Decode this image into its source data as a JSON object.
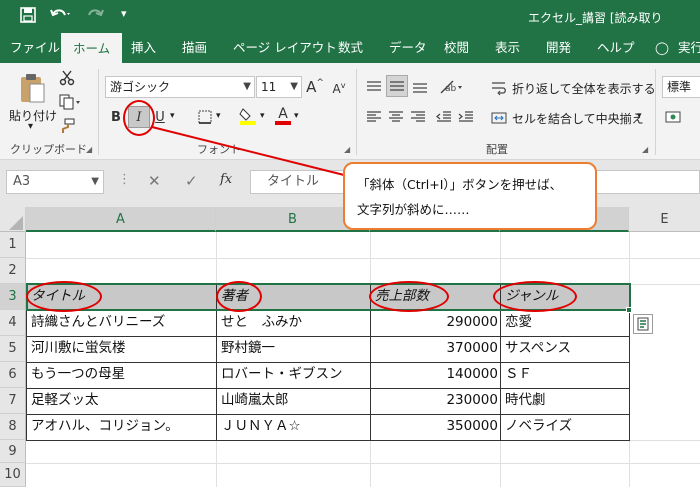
{
  "titlebar": {
    "title": "エクセル_講習 [読み取り",
    "save_icon": "save-icon",
    "undo_icon": "undo-icon",
    "redo_icon": "redo-icon",
    "customize_icon": "customize-quick-access-icon"
  },
  "tabs": [
    "ファイル",
    "ホーム",
    "挿入",
    "描画",
    "ページ レイアウト",
    "数式",
    "データ",
    "校閲",
    "表示",
    "開発",
    "ヘルプ",
    "実行"
  ],
  "ribbon": {
    "clipboard": {
      "paste_label": "貼り付け",
      "group_label": "クリップボード"
    },
    "font": {
      "font_name": "游ゴシック",
      "font_size": "11",
      "bold": "B",
      "italic": "I",
      "underline": "U",
      "grow": "A",
      "shrink": "A",
      "group_label": "フォント"
    },
    "alignment": {
      "wrap_text": "折り返して全体を表示する",
      "merge_center": "セルを結合して中央揃え",
      "group_label": "配置"
    },
    "number": {
      "format": "標準"
    }
  },
  "formula_bar": {
    "name_box": "A3",
    "cancel": "✕",
    "enter": "✓",
    "fx": "fx",
    "content": "タイトル"
  },
  "grid": {
    "columns": [
      "A",
      "B",
      "C",
      "D",
      "E"
    ],
    "rows": [
      "1",
      "2",
      "3",
      "4",
      "5",
      "6",
      "7",
      "8",
      "9",
      "10"
    ],
    "header": [
      "タイトル",
      "著者",
      "売上部数",
      "ジャンル"
    ],
    "data": [
      [
        "詩織さんとバリニーズ",
        "せと　ふみか",
        "290000",
        "恋愛"
      ],
      [
        "河川敷に蛍気楼",
        "野村鏡一",
        "370000",
        "サスペンス"
      ],
      [
        "もう一つの母星",
        "ロバート・ギブスン",
        "140000",
        "ＳＦ"
      ],
      [
        "足軽ズッ太",
        "山崎嵐太郎",
        "230000",
        "時代劇"
      ],
      [
        "アオハル、コリジョン。",
        "ＪＵＮＹＡ☆",
        "350000",
        "ノベライズ"
      ]
    ]
  },
  "callout": {
    "line1": "「斜体（Ctrl+I）」ボタンを押せば、",
    "line2": "文字列が斜めに……"
  },
  "colors": {
    "accent": "#217346",
    "annotation": "#e00000",
    "callout_border": "#ed7d31",
    "header_fill": "#c8c8c8"
  }
}
